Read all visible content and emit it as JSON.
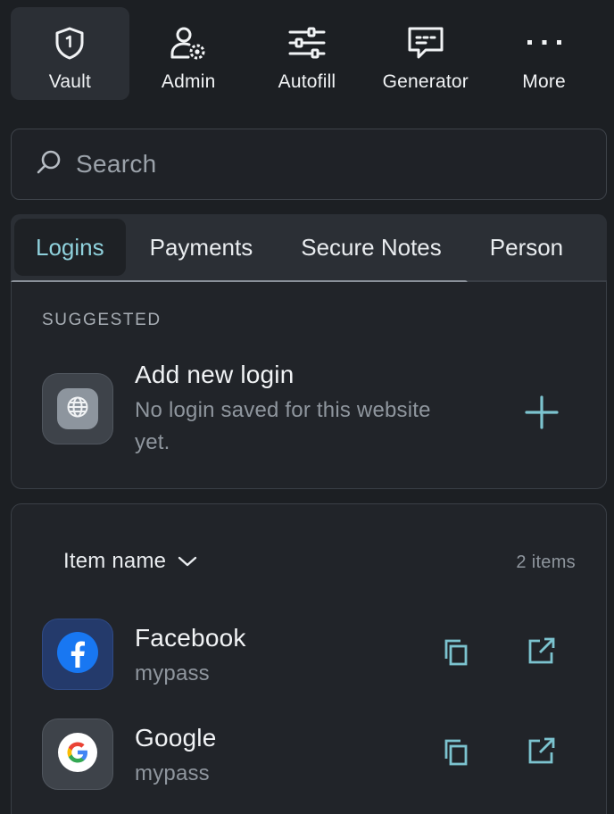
{
  "nav": {
    "items": [
      {
        "label": "Vault",
        "icon": "shield-icon",
        "active": true
      },
      {
        "label": "Admin",
        "icon": "admin-user-gear-icon",
        "active": false
      },
      {
        "label": "Autofill",
        "icon": "sliders-icon",
        "active": false
      },
      {
        "label": "Generator",
        "icon": "chat-generator-icon",
        "active": false
      },
      {
        "label": "More",
        "icon": "more-dots-icon",
        "active": false
      }
    ]
  },
  "search": {
    "placeholder": "Search",
    "value": ""
  },
  "tabs": [
    {
      "label": "Logins",
      "active": true
    },
    {
      "label": "Payments",
      "active": false
    },
    {
      "label": "Secure Notes",
      "active": false
    },
    {
      "label": "Person",
      "active": false
    }
  ],
  "suggested": {
    "title": "SUGGESTED",
    "item": {
      "title": "Add new login",
      "subtitle_line1": "No login saved for this website",
      "subtitle_line2": "yet."
    }
  },
  "list": {
    "sort_label": "Item name",
    "count": "2 items",
    "items": [
      {
        "name": "Facebook",
        "username": "mypass",
        "icon": "facebook-icon"
      },
      {
        "name": "Google",
        "username": "mypass",
        "icon": "google-icon"
      }
    ]
  },
  "colors": {
    "background": "#1c1f23",
    "card": "#212429",
    "accent": "#8fd1dc",
    "action": "#7cc3cf"
  }
}
